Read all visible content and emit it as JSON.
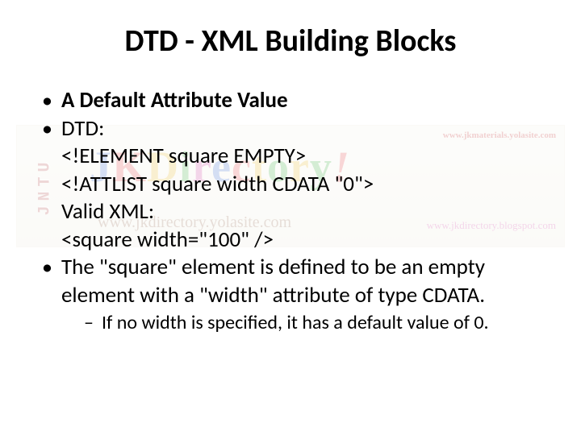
{
  "title": "DTD - XML Building Blocks",
  "bullets": {
    "b1": "A Default Attribute Value",
    "b2": {
      "intro": "DTD:",
      "line1": "<!ELEMENT square EMPTY>",
      "line2": "<!ATTLIST square width CDATA \"0\">",
      "validLabel": "Valid XML:",
      "validLine": "<square width=\"100\" />"
    },
    "b3": "The \"square\" element is defined to be an empty element with a \"width\" attribute of  type CDATA.",
    "sub1": "If no width is specified, it has a default value of 0."
  },
  "watermark": {
    "vertical": "JNTU",
    "topRight": "www.jkmaterials.yolasite.com",
    "logoJ": "J",
    "logoK": "K",
    "logoRest": "Directory",
    "excl": "!",
    "subSite": "www.jkdirectory.yolasite.com",
    "blog": "www.jkdirectory.blogspot.com"
  }
}
